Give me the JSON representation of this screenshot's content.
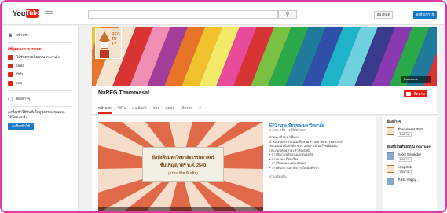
{
  "header": {
    "logo_you": "You",
    "logo_tube": "Tube",
    "search_icon": "magnifier-icon",
    "upload_label": "อัปโหลด",
    "signin_label": "ลงชื่อเข้าใช้"
  },
  "sidebar": {
    "home_label": "หน้าแรก",
    "best_heading": "ดีที่สุดของ YOUTUBE",
    "items": [
      {
        "label": "ได้รับความนิยมบน YouTube"
      },
      {
        "label": "เพลง"
      },
      {
        "label": "กีฬา"
      },
      {
        "label": "เกม"
      }
    ],
    "browse_label": "ช่องต่างๆ",
    "signin_text": "ลงชื่อเข้าใช้ทันทีเพื่อดูช่องของคุณและวิดีโอแนะนำ",
    "signin_button": "ลงชื่อเข้าใช้"
  },
  "banner": {
    "avatar_text_1": "REG",
    "avatar_text_2": "TU",
    "avatar_text_3": "TV",
    "facebook_link": "Facebook"
  },
  "channel": {
    "title": "NuREG Thammasat",
    "subscribe_label": "ติดตาม",
    "tabs": [
      "หน้าแรก",
      "วิดีโอ",
      "เพลย์ลิสต์",
      "ช่อง",
      "พูดคุย",
      "เกี่ยวกับ"
    ],
    "search_icon": "magnifier-icon"
  },
  "featured": {
    "thumb_line1": "ข้อบังคับมหาวิทยาลัยธรรมศาสตร์",
    "thumb_line2": "ชั้นปริญญาตรี พ.ศ. 2540",
    "thumb_line3": "(ฉบับแก้ไขเพิ่มเติม)",
    "title": "EP1 กฎระเบียบของมหาวิทยาลัย",
    "meta": "1,738 ครั้ง · 1 ปีที่ผ่านมา",
    "description": [
      "ฝ่ายทะเบียนนักศึกษา",
      "สำนักงานทะเบียนนักศึกษามหาวิทยาลัยธรรมศาสตร์",
      "ขอแนะนำข้อบังคับ พ.ศ. 2540 ฉบับแก้ไขเพิ่มเติม",
      "",
      "ประกอบด้วยสาระสำคัญดังนี้",
      "• การจัดการศึกษาแบบหน่วยกิต",
      "• การลงทะเบียนเรียน",
      "• การวัดผลและประเมินผล",
      "• การพ้นสถานภาพการเป็นนักศึกษา"
    ],
    "read_more": "อ่านเพิ่มเติม"
  },
  "right_column": {
    "channels_heading": "ช่องต่างๆ",
    "channel_1_name": "Thammasat REG...",
    "channel_1_button": "ติดตาม",
    "popular_heading": "ช่องที่เป็นที่นิยมบน YouTube",
    "channel_2_name": "Jukkit Srisakdee",
    "channel_2_button": "ติดตาม",
    "channel_3_name": "pctopclub",
    "channel_3_button": "ติดตาม",
    "channel_4_name": "Tukta Happy..."
  },
  "colors": {
    "youtube_red": "#e62117",
    "link_blue": "#167ac6",
    "frame_pink": "#d63fa0"
  }
}
